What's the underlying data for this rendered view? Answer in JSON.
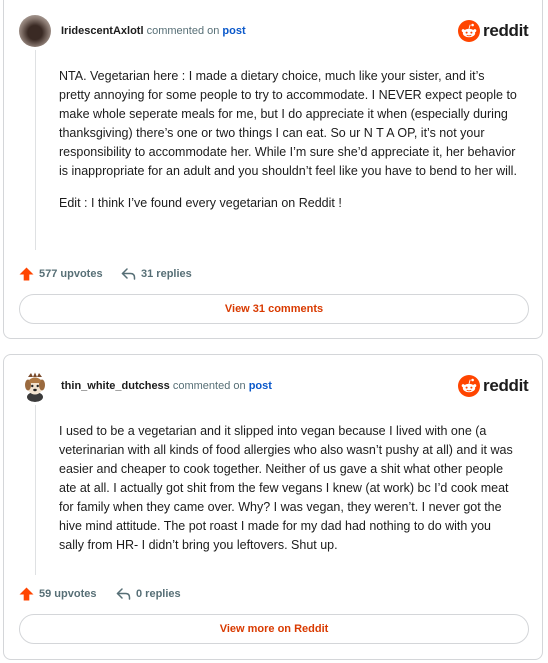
{
  "comments": [
    {
      "username": "IridescentAxlotl",
      "commented_on": "commented on",
      "post_label": "post",
      "brand": "reddit",
      "paragraphs": [
        "NTA. Vegetarian here : I made a dietary choice, much like your sister, and it’s pretty annoying for some people to try to accommodate. I NEVER expect people to make whole seperate meals for me, but I do appreciate it when (especially during thanksgiving) there’s one or two things I can eat. So ur N T A OP, it’s not your responsibility to accommodate her. While I’m sure she’d appreciate it, her behavior is inappropriate for an adult and you shouldn’t feel like you have to bend to her will.",
        "Edit : I think I’ve found every vegetarian on Reddit !"
      ],
      "upvotes": "577 upvotes",
      "replies": "31 replies",
      "button": "View 31 comments"
    },
    {
      "username": "thin_white_dutchess",
      "commented_on": "commented on",
      "post_label": "post",
      "brand": "reddit",
      "paragraphs": [
        "I used to be a vegetarian and it slipped into vegan because I lived with one (a veterinarian with all kinds of food allergies who also wasn’t pushy at all) and it was easier and cheaper to cook together. Neither of us gave a shit what other people ate at all. I actually got shit from the few vegans I knew (at work) bc I’d cook meat for family when they came over. Why? I was vegan, they weren’t. I never got the hive mind attitude. The pot roast I made for my dad had nothing to do with you sally from HR- I didn’t bring you leftovers. Shut up."
      ],
      "upvotes": "59 upvotes",
      "replies": "0 replies",
      "button": "View more on Reddit"
    }
  ],
  "colors": {
    "upvote": "#ff4500",
    "link": "#0a58ca",
    "button_text": "#d93a00",
    "muted": "#576f76"
  },
  "icons": {
    "brand": "reddit-snoo-icon",
    "upvote": "upvote-arrow-icon",
    "reply": "reply-arrow-icon"
  }
}
